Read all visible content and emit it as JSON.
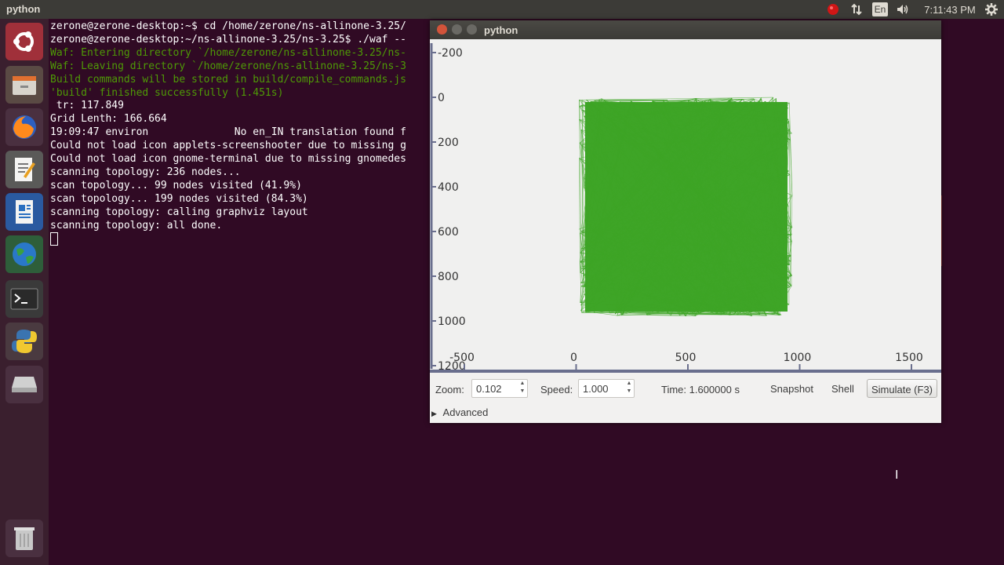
{
  "topbar": {
    "app_title": "python",
    "indicators": [
      "record-icon",
      "network-icon",
      "keyboard-layout",
      "volume-icon",
      "clock",
      "settings-icon"
    ],
    "keyboard_layout": "En",
    "clock": "7:11:43 PM",
    "colors": {
      "bar": "#3c3b37",
      "record": "#d01616"
    }
  },
  "launcher": {
    "items": [
      "ubuntu-dash-icon",
      "file-manager-icon",
      "firefox-icon",
      "text-editor-icon",
      "writer-icon",
      "browser-globe-icon",
      "terminal-icon",
      "python-icon",
      "drive-icon",
      "trash-icon"
    ]
  },
  "terminal": {
    "lines": [
      {
        "text": "zerone@zerone-desktop:~$ cd /home/zerone/ns-allinone-3.25/",
        "cls": ""
      },
      {
        "text": "zerone@zerone-desktop:~/ns-allinone-3.25/ns-3.25$ ./waf --",
        "cls": ""
      },
      {
        "text": "Waf: Entering directory `/home/zerone/ns-allinone-3.25/ns-",
        "cls": "g"
      },
      {
        "text": "Waf: Leaving directory `/home/zerone/ns-allinone-3.25/ns-3",
        "cls": "g"
      },
      {
        "text": "Build commands will be stored in build/compile_commands.js",
        "cls": "g"
      },
      {
        "text": "'build' finished successfully (1.451s)",
        "cls": "g"
      },
      {
        "text": " tr: 117.849",
        "cls": ""
      },
      {
        "text": "Grid Lenth: 166.664",
        "cls": ""
      },
      {
        "text": "19:09:47 environ              No en_IN translation found f",
        "cls": ""
      },
      {
        "text": "Could not load icon applets-screenshooter due to missing g",
        "cls": ""
      },
      {
        "text": "Could not load icon gnome-terminal due to missing gnomedes",
        "cls": ""
      },
      {
        "text": "scanning topology: 236 nodes...",
        "cls": ""
      },
      {
        "text": "scan topology... 99 nodes visited (41.9%)",
        "cls": ""
      },
      {
        "text": "scan topology... 199 nodes visited (84.3%)",
        "cls": ""
      },
      {
        "text": "scanning topology: calling graphviz layout",
        "cls": ""
      },
      {
        "text": "scanning topology: all done.",
        "cls": ""
      }
    ],
    "colors": {
      "background": "#300a24",
      "text": "#ffffff",
      "green": "#4e9a06"
    }
  },
  "pywindow": {
    "title": "python",
    "canvas": {
      "y_ticks": [
        "-200",
        "0",
        "200",
        "400",
        "600",
        "800",
        "1000",
        "1200"
      ],
      "x_ticks": [
        "-500",
        "0",
        "500",
        "1000",
        "1500"
      ],
      "node_count": 236,
      "link_color": "#3ea527"
    },
    "controls": {
      "zoom_label": "Zoom:",
      "zoom_value": "0.102",
      "speed_label": "Speed:",
      "speed_value": "1.000",
      "time_text": "Time: 1.600000 s",
      "snapshot_label": "Snapshot",
      "shell_label": "Shell",
      "simulate_label": "Simulate (F3)"
    },
    "advanced_label": "Advanced"
  }
}
